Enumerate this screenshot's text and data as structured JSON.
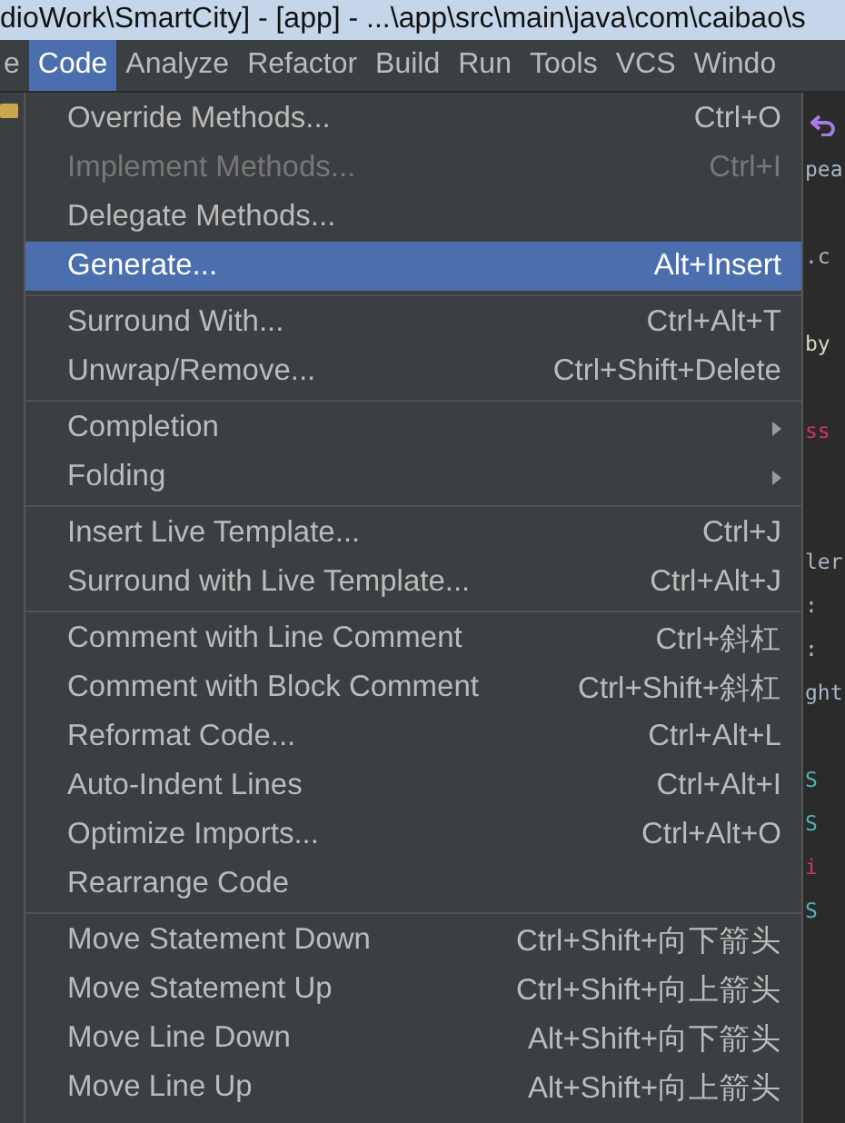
{
  "window": {
    "title": "dioWork\\SmartCity] - [app] - ...\\app\\src\\main\\java\\com\\caibao\\s"
  },
  "menubar": [
    {
      "label": "e",
      "selected": false
    },
    {
      "label": "Code",
      "selected": true
    },
    {
      "label": "Analyze",
      "selected": false
    },
    {
      "label": "Refactor",
      "selected": false
    },
    {
      "label": "Build",
      "selected": false
    },
    {
      "label": "Run",
      "selected": false
    },
    {
      "label": "Tools",
      "selected": false
    },
    {
      "label": "VCS",
      "selected": false
    },
    {
      "label": "Windo",
      "selected": false
    }
  ],
  "menu": {
    "sections": [
      [
        {
          "label": "Override Methods...",
          "shortcut": "Ctrl+O",
          "disabled": false,
          "selected": false,
          "submenu": false
        },
        {
          "label": "Implement Methods...",
          "shortcut": "Ctrl+I",
          "disabled": true,
          "selected": false,
          "submenu": false
        },
        {
          "label": "Delegate Methods...",
          "disabled": false,
          "selected": false,
          "submenu": false
        },
        {
          "label": "Generate...",
          "shortcut": "Alt+Insert",
          "disabled": false,
          "selected": true,
          "submenu": false
        }
      ],
      [
        {
          "label": "Surround With...",
          "shortcut": "Ctrl+Alt+T",
          "disabled": false,
          "selected": false,
          "submenu": false
        },
        {
          "label": "Unwrap/Remove...",
          "shortcut": "Ctrl+Shift+Delete",
          "disabled": false,
          "selected": false,
          "submenu": false
        }
      ],
      [
        {
          "label": "Completion",
          "disabled": false,
          "selected": false,
          "submenu": true
        },
        {
          "label": "Folding",
          "disabled": false,
          "selected": false,
          "submenu": true
        }
      ],
      [
        {
          "label": "Insert Live Template...",
          "shortcut": "Ctrl+J",
          "disabled": false,
          "selected": false,
          "submenu": false
        },
        {
          "label": "Surround with Live Template...",
          "shortcut": "Ctrl+Alt+J",
          "disabled": false,
          "selected": false,
          "submenu": false
        }
      ],
      [
        {
          "label": "Comment with Line Comment",
          "shortcut": "Ctrl+斜杠",
          "disabled": false,
          "selected": false,
          "submenu": false
        },
        {
          "label": "Comment with Block Comment",
          "shortcut": "Ctrl+Shift+斜杠",
          "disabled": false,
          "selected": false,
          "submenu": false
        },
        {
          "label": "Reformat Code...",
          "shortcut": "Ctrl+Alt+L",
          "disabled": false,
          "selected": false,
          "submenu": false
        },
        {
          "label": "Auto-Indent Lines",
          "shortcut": "Ctrl+Alt+I",
          "disabled": false,
          "selected": false,
          "submenu": false
        },
        {
          "label": "Optimize Imports...",
          "shortcut": "Ctrl+Alt+O",
          "disabled": false,
          "selected": false,
          "submenu": false
        },
        {
          "label": "Rearrange Code",
          "disabled": false,
          "selected": false,
          "submenu": false
        }
      ],
      [
        {
          "label": "Move Statement Down",
          "shortcut": "Ctrl+Shift+向下箭头",
          "disabled": false,
          "selected": false,
          "submenu": false
        },
        {
          "label": "Move Statement Up",
          "shortcut": "Ctrl+Shift+向上箭头",
          "disabled": false,
          "selected": false,
          "submenu": false
        },
        {
          "label": "Move Line Down",
          "shortcut": "Alt+Shift+向下箭头",
          "disabled": false,
          "selected": false,
          "submenu": false
        },
        {
          "label": "Move Line Up",
          "shortcut": "Alt+Shift+向上箭头",
          "disabled": false,
          "selected": false,
          "submenu": false
        }
      ]
    ]
  },
  "editor_fragments": [
    {
      "kind": "undo"
    },
    {
      "kind": "text",
      "text": "pea",
      "color": "#a9b7c6"
    },
    {
      "kind": "blank"
    },
    {
      "kind": "text",
      "text": ".c",
      "color": "#a9b7c6"
    },
    {
      "kind": "blank"
    },
    {
      "kind": "text",
      "text": "by",
      "color": "#d8d8c8"
    },
    {
      "kind": "blank"
    },
    {
      "kind": "text",
      "text": "ss",
      "color": "#cc3377"
    },
    {
      "kind": "blank"
    },
    {
      "kind": "blank"
    },
    {
      "kind": "text",
      "text": "ler",
      "color": "#a9b7c6"
    },
    {
      "kind": "text",
      "text": ":",
      "color": "#a9b7c6"
    },
    {
      "kind": "text",
      "text": ":",
      "color": "#a9b7c6"
    },
    {
      "kind": "text",
      "text": "ght",
      "color": "#a9b7c6"
    },
    {
      "kind": "blank"
    },
    {
      "kind": "text",
      "text": "S",
      "color": "#4fb4b4"
    },
    {
      "kind": "text",
      "text": "S",
      "color": "#4fb4b4"
    },
    {
      "kind": "text",
      "text": "i",
      "color": "#cc3377"
    },
    {
      "kind": "text",
      "text": "S",
      "color": "#4fb4b4"
    }
  ]
}
